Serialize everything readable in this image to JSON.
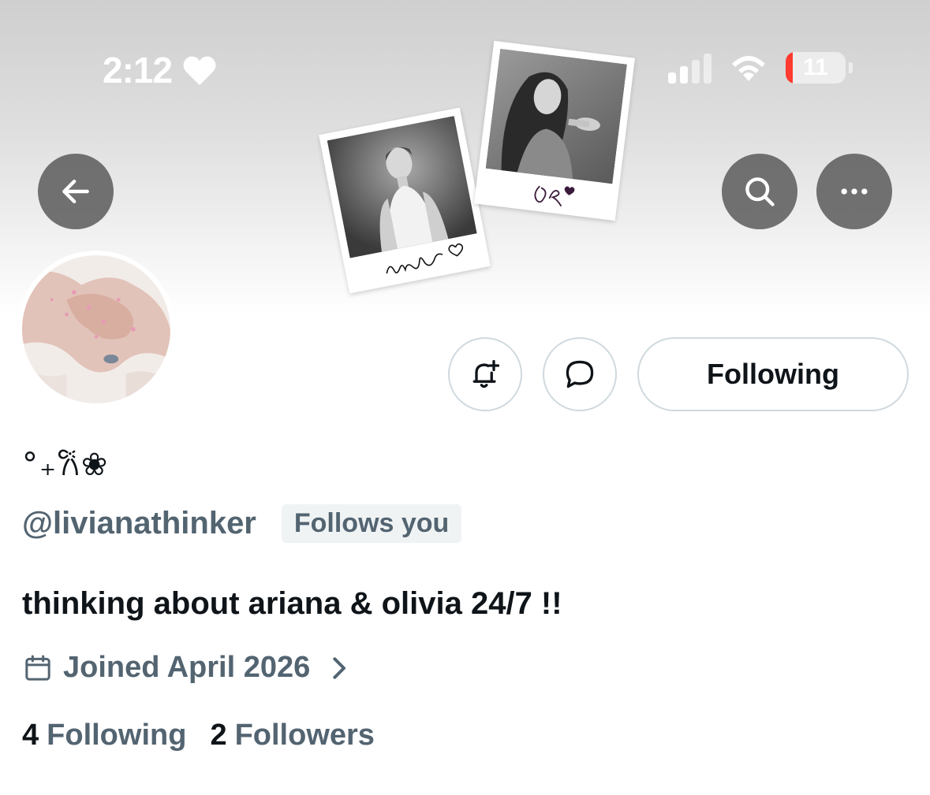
{
  "status_bar": {
    "time": "2:12",
    "battery": "11"
  },
  "header": {
    "back_icon": "arrow-left-icon",
    "search_icon": "search-icon",
    "more_icon": "more-horizontal-icon"
  },
  "actions": {
    "notify_icon": "bell-plus-icon",
    "message_icon": "chat-bubble-icon",
    "follow_label": "Following"
  },
  "profile": {
    "display_name": "°₊𐙚❀",
    "handle": "@livianathinker",
    "follows_you": "Follows you",
    "bio": "thinking about ariana & olivia 24/7 !!",
    "joined": "Joined April 2026",
    "following_count": "4",
    "following_label": "Following",
    "followers_count": "2",
    "followers_label": "Followers"
  },
  "colors": {
    "primary_text": "#0f1419",
    "secondary_text": "#536471",
    "border": "#cfd9de",
    "badge_bg": "#eff3f4",
    "battery_low": "#ff3b30"
  }
}
